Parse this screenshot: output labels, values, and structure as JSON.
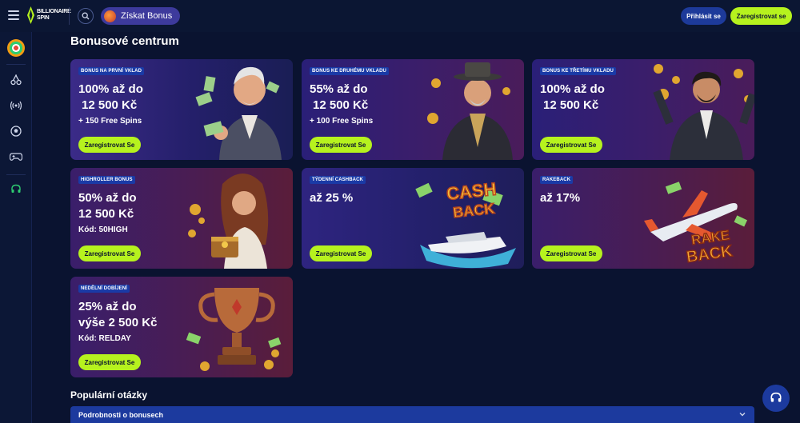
{
  "header": {
    "logo_line1": "BILLIONAIRE",
    "logo_line2": "SPIN",
    "bonus_button": "Získat Bonus",
    "login": "Přihlásit se",
    "register": "Zaregistrovat se"
  },
  "colors": {
    "accent_green": "#b6f21e",
    "primary_blue": "#1c3a9e",
    "background": "#0a1330"
  },
  "sidebar": {
    "items": [
      {
        "icon": "target-icon"
      },
      {
        "icon": "cherries-icon"
      },
      {
        "icon": "live-broadcast-icon"
      },
      {
        "icon": "soccer-ball-icon"
      },
      {
        "icon": "gamepad-icon"
      },
      {
        "icon": "headset-icon"
      }
    ]
  },
  "main": {
    "title": "Bonusové centrum",
    "cards": [
      {
        "tag": "BONUS NA PRVNÍ VKLAD",
        "line1": "100% až do",
        "line2": "12 500 Kč",
        "sub": "+ 150 Free Spins",
        "cta": "Zaregistrovat Se",
        "art": "businessman-with-cash"
      },
      {
        "tag": "BONUS KE DRUHÉMU VKLADU",
        "line1": "55% až do",
        "line2": "12 500 Kč",
        "sub": "+ 100 Free Spins",
        "cta": "Zaregistrovat Se",
        "art": "gentleman-with-hat"
      },
      {
        "tag": "BONUS KE TŘETÍMU VKLADU",
        "line1": "100% až do",
        "line2": "12 500 Kč",
        "sub": "",
        "cta": "Zaregistrovat Se",
        "art": "man-with-coins"
      },
      {
        "tag": "HIGHROLLER BONUS",
        "line1": "50% až do",
        "line2": "12 500 Kč",
        "sub": "Kód: 50HIGH",
        "cta": "Zaregistrovat Se",
        "art": "woman-with-treasure"
      },
      {
        "tag": "TÝDENNÍ CASHBACK",
        "line1": "až 25 %",
        "line2": "",
        "sub": "",
        "cta": "Zaregistrovat Se",
        "art": "cash-back-yacht",
        "art_text1": "CASH",
        "art_text2": "BACK"
      },
      {
        "tag": "RAKEBACK",
        "line1": "až 17%",
        "line2": "",
        "sub": "",
        "cta": "Zaregistrovat Se",
        "art": "rake-back-plane",
        "art_text1": "RAKE",
        "art_text2": "BACK"
      },
      {
        "tag": "NEDĚLNÍ DOBÍJENÍ",
        "line1": "25% až do",
        "line2": "výše 2 500 Kč",
        "sub": "Kód: RELDAY",
        "cta": "Zaregistrovat Se",
        "art": "trophy-with-coins"
      }
    ]
  },
  "faq": {
    "title": "Populární otázky",
    "items": [
      {
        "question": "Podrobnosti o bonusech"
      }
    ]
  }
}
